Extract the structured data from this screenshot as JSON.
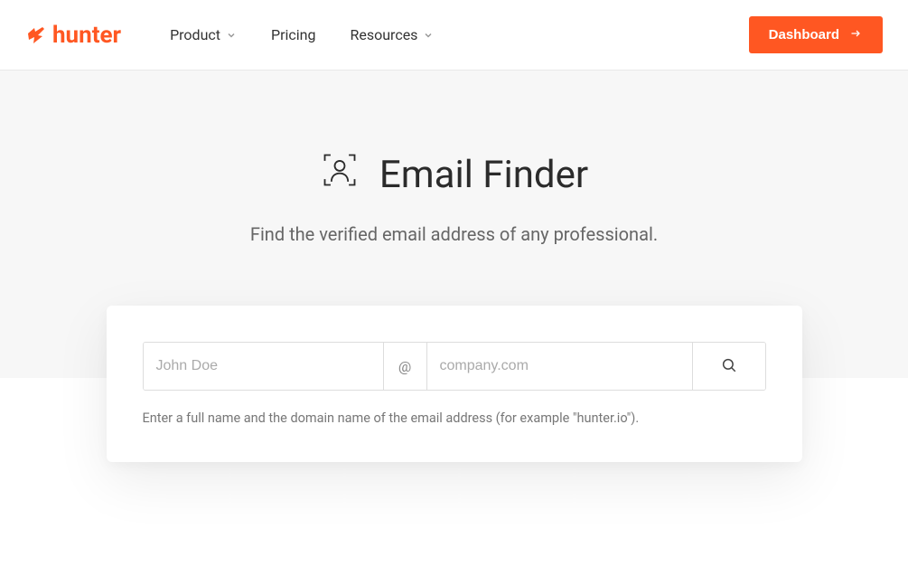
{
  "brand": {
    "name": "hunter"
  },
  "nav": {
    "product": "Product",
    "pricing": "Pricing",
    "resources": "Resources",
    "dashboard": "Dashboard"
  },
  "hero": {
    "title": "Email Finder",
    "subtitle": "Find the verified email address of any professional."
  },
  "form": {
    "name_placeholder": "John Doe",
    "at_separator": "@",
    "domain_placeholder": "company.com",
    "hint": "Enter a full name and the domain name of the email address (for example \"hunter.io\")."
  }
}
